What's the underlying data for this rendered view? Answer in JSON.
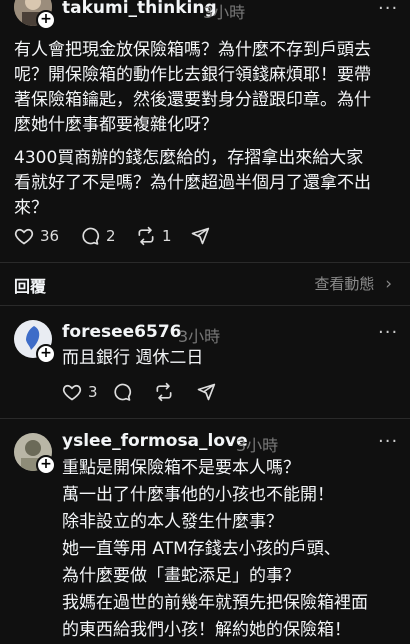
{
  "post1": {
    "username": "takumi_thinking",
    "time": "3小時",
    "more": "···",
    "paragraph1": [
      "有人會把現金放保險箱嗎？為什麼不存到戶頭去",
      "呢？開保險箱的動作比去銀行領錢麻煩耶！要帶",
      "著保險箱鑰匙，然後還要對身分證跟印章。為什",
      "麼她什麼事都要複雜化呀？"
    ],
    "paragraph2": [
      "4300買商辦的錢怎麼給的，存摺拿出來給大家",
      "看就好了不是嗎？為什麼超過半個月了還拿不出",
      "來？"
    ],
    "likes": "36",
    "comments": "2",
    "reposts": "1"
  },
  "replies_header": {
    "label": "回覆",
    "view_activity": "查看動態",
    "chevron": "›"
  },
  "post2": {
    "username": "foresee6576",
    "time": "3小時",
    "more": "···",
    "text": "而且銀行 週休二日",
    "likes": "3"
  },
  "post3": {
    "username": "yslee_formosa_love",
    "time": "3小時",
    "more": "···",
    "lines": [
      "重點是開保險箱不是要本人嗎？",
      "萬一出了什麼事他的小孩也不能開！",
      "除非設立的本人發生什麼事？",
      "她一直等用 ATM存錢去小孩的戶頭、",
      "為什麼要做「畫蛇添足」的事？",
      "我媽在過世的前幾年就預先把保險箱裡面",
      "的東西給我們小孩！解約她的保險箱！"
    ]
  }
}
